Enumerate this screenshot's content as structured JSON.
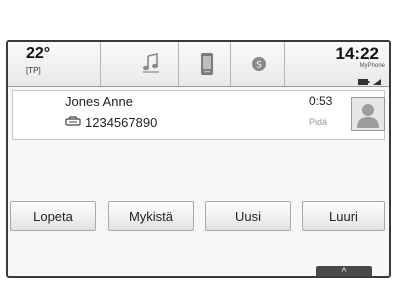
{
  "status_bar": {
    "temperature": "22°",
    "traffic_program": "[TP]",
    "time": "14:22",
    "phone_label": "MyPhone"
  },
  "call": {
    "caller_name": "Jones Anne",
    "phone_number": "1234567890",
    "duration": "0:53",
    "hold_label": "Pidä"
  },
  "buttons": {
    "end_label": "Lopeta",
    "mute_label": "Mykistä",
    "new_label": "Uusi",
    "handset_label": "Luuri"
  },
  "handle": {
    "glyph": "^"
  },
  "colors": {
    "frame": "#3a3a3a",
    "status_bg": "#f0f0f0",
    "handle_bg": "#4a4a4a",
    "hold_text": "#9a9a9a"
  }
}
